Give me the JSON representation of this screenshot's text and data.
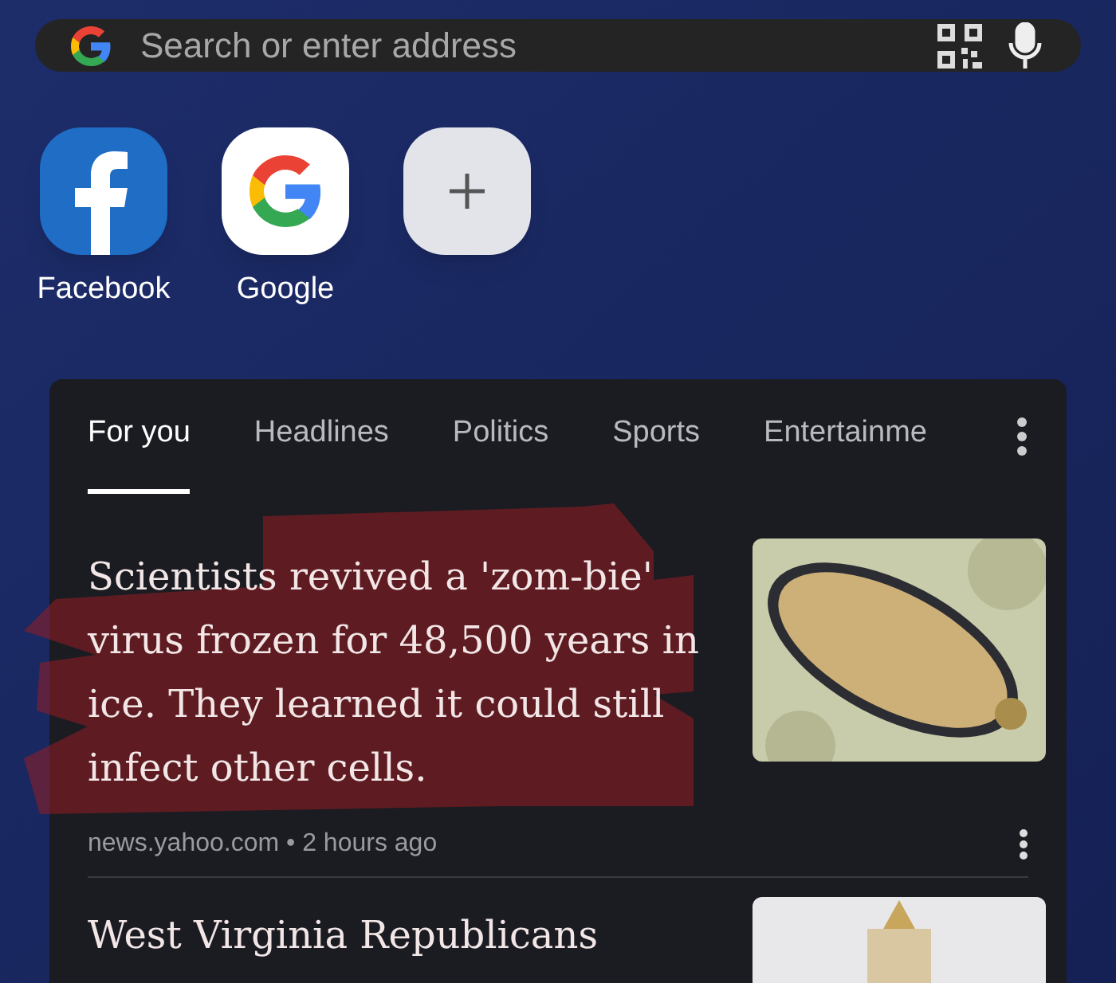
{
  "search_bar": {
    "placeholder": "Search or enter address"
  },
  "shortcuts": [
    {
      "kind": "facebook",
      "label": "Facebook"
    },
    {
      "kind": "google",
      "label": "Google"
    },
    {
      "kind": "add"
    }
  ],
  "feed": {
    "tabs": [
      {
        "label": "For you",
        "selected": true
      },
      {
        "label": "Headlines",
        "selected": false
      },
      {
        "label": "Politics",
        "selected": false
      },
      {
        "label": "Sports",
        "selected": false
      },
      {
        "label": "Entertainme",
        "selected": false
      }
    ],
    "articles": [
      {
        "headline": "Scientists revived a 'zom-bie' virus frozen for 48,500 years in ice. They learned it could still infect other cells.",
        "source": "news.yahoo.com",
        "separator": "•",
        "time": "2 hours ago",
        "highlighted": true
      },
      {
        "headline": "West Virginia Republicans",
        "highlighted": false
      }
    ]
  }
}
